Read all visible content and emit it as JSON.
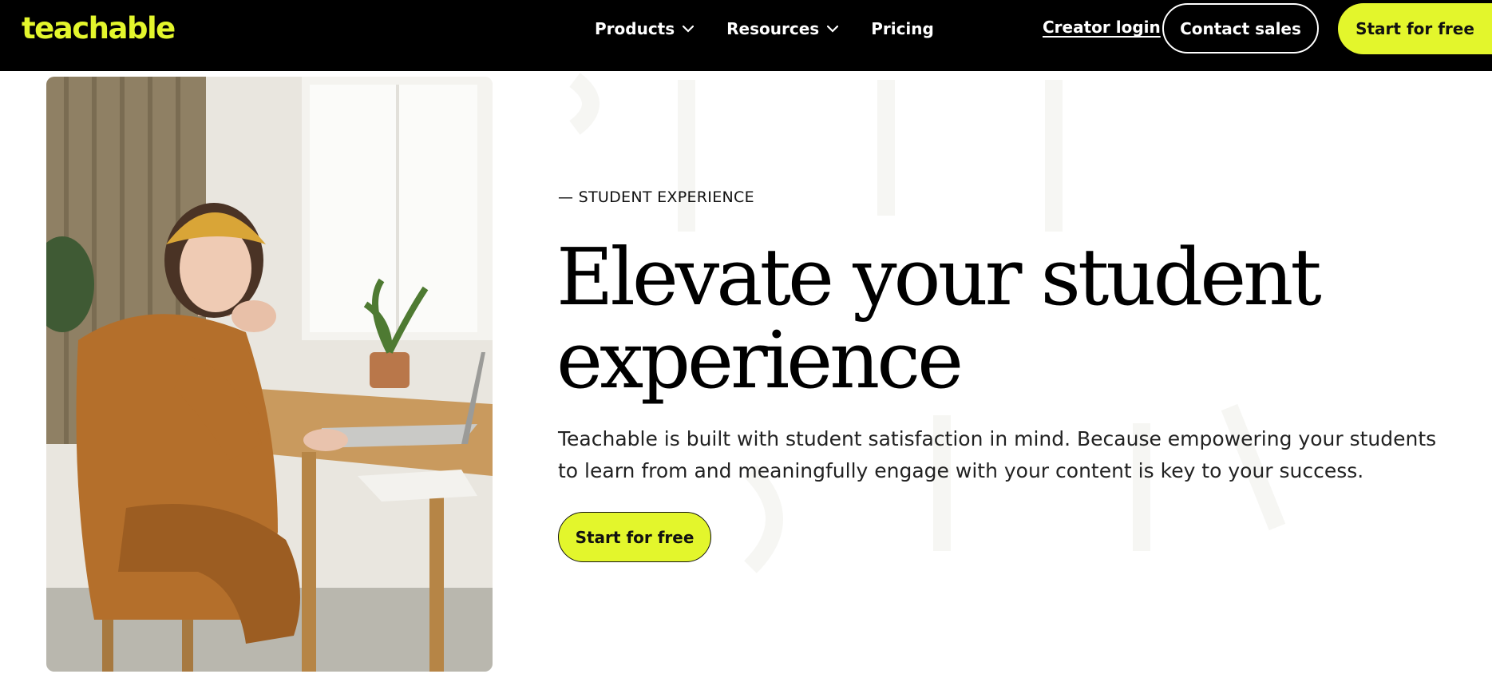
{
  "header": {
    "logo_text": "teachable",
    "nav": [
      {
        "label": "Products",
        "has_dropdown": true
      },
      {
        "label": "Resources",
        "has_dropdown": true
      },
      {
        "label": "Pricing",
        "has_dropdown": false
      }
    ],
    "creator_login": "Creator login",
    "contact_sales": "Contact sales",
    "start_free": "Start for free"
  },
  "hero": {
    "eyebrow": "— STUDENT EXPERIENCE",
    "headline_line1": "Elevate your student",
    "headline_line2": "experience",
    "body": "Teachable is built with student satisfaction in mind. Because empowering your students to learn from and meaningfully engage with your content is key to your success.",
    "cta": "Start for free",
    "image_icon": "photo-student-at-laptop"
  },
  "colors": {
    "brand_accent": "#e3f62c",
    "header_bg": "#000000",
    "text": "#111111"
  }
}
